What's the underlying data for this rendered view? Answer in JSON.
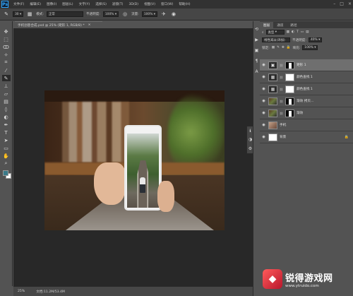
{
  "app": {
    "logo": "Ps",
    "menu": [
      "文件(F)",
      "编辑(E)",
      "图像(I)",
      "图层(L)",
      "文字(Y)",
      "选择(S)",
      "滤镜(T)",
      "3D(D)",
      "视图(V)",
      "窗口(W)",
      "帮助(H)"
    ]
  },
  "options": {
    "size": "30",
    "mode_label": "模式:",
    "mode_value": "正常",
    "opacity_label": "不透明度:",
    "opacity_value": "100%",
    "flow_label": "流量:",
    "flow_value": "100%"
  },
  "document": {
    "tab_title": "手机创意合成.psd @ 25% (矩形 1, RGB/8) *",
    "zoom": "25%",
    "doc_info": "文档:11.2M/53.4M"
  },
  "colors": {
    "foreground": "#3a7a89",
    "background": "#ffffff"
  },
  "layers_panel": {
    "tabs": [
      "图层",
      "通道",
      "路径"
    ],
    "filter_label": "类型",
    "blend_mode": "线性减淡(添加)",
    "opacity_label": "不透明度:",
    "opacity_value": "40%",
    "lock_label": "锁定:",
    "fill_label": "填充:",
    "fill_value": "100%",
    "layers": [
      {
        "name": "矩形 1",
        "selected": true
      },
      {
        "name": "颜色查找 1",
        "selected": false
      },
      {
        "name": "颜色查找 1",
        "selected": false
      },
      {
        "name": "渐效 拷贝...",
        "selected": false
      },
      {
        "name": "渐效",
        "selected": false
      },
      {
        "name": "手机",
        "selected": false
      },
      {
        "name": "背景",
        "selected": false
      }
    ]
  },
  "watermark": {
    "title": "锐得游戏网",
    "url": "www.ytruido.com"
  },
  "icons": {
    "tools": [
      "move-icon",
      "marquee-icon",
      "lasso-icon",
      "quick-select-icon",
      "crop-icon",
      "eyedropper-icon",
      "healing-icon",
      "brush-icon",
      "stamp-icon",
      "history-brush-icon",
      "eraser-icon",
      "gradient-icon",
      "blur-icon",
      "dodge-icon",
      "pen-icon",
      "type-icon",
      "path-select-icon",
      "shape-icon",
      "hand-icon",
      "zoom-icon"
    ]
  }
}
